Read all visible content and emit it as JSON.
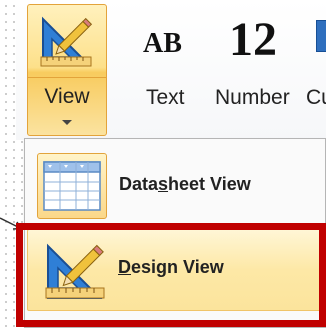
{
  "ribbon": {
    "view_button": {
      "label": "View"
    },
    "field_items": [
      {
        "glyph": "AB",
        "label": "Text"
      },
      {
        "glyph": "12",
        "label": "Number"
      },
      {
        "label": "Cu"
      }
    ]
  },
  "view_menu": {
    "items": [
      {
        "label_before": "Data",
        "label_accel": "s",
        "label_after": "heet View",
        "icon": "datasheet-grid-icon"
      },
      {
        "label_before": "",
        "label_accel": "D",
        "label_after": "esign View",
        "icon": "design-ruler-pencil-icon",
        "highlighted": true
      }
    ]
  },
  "colors": {
    "highlight_frame": "#c00000",
    "button_gold": "#fde08a",
    "icon_blue": "#2f6fbe"
  }
}
